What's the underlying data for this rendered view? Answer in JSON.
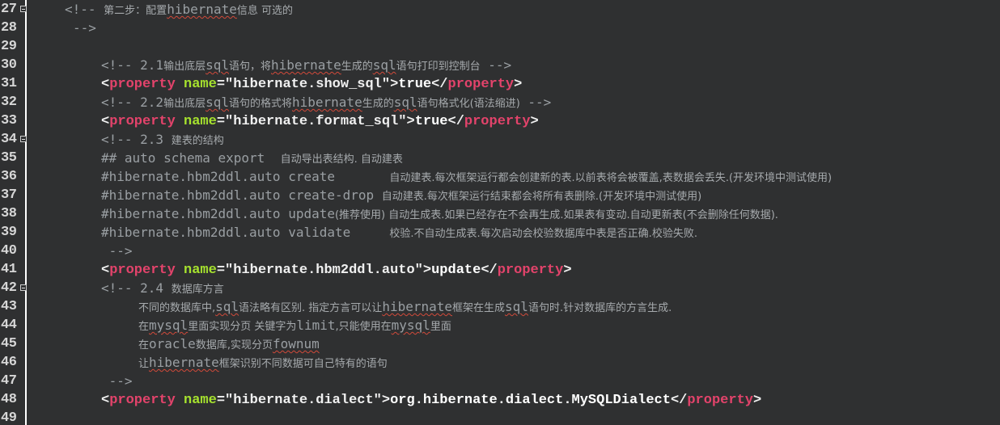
{
  "editor": {
    "lines": [
      {
        "num": "27",
        "fold": true
      },
      {
        "num": "28"
      },
      {
        "num": "29"
      },
      {
        "num": "30"
      },
      {
        "num": "31"
      },
      {
        "num": "32"
      },
      {
        "num": "33"
      },
      {
        "num": "34",
        "fold": true
      },
      {
        "num": "35"
      },
      {
        "num": "36"
      },
      {
        "num": "37"
      },
      {
        "num": "38"
      },
      {
        "num": "39"
      },
      {
        "num": "40"
      },
      {
        "num": "41"
      },
      {
        "num": "42",
        "fold": true
      },
      {
        "num": "43"
      },
      {
        "num": "44"
      },
      {
        "num": "45"
      },
      {
        "num": "46"
      },
      {
        "num": "47"
      },
      {
        "num": "48"
      },
      {
        "num": "49"
      }
    ],
    "code": {
      "l27_a": "<!-- ",
      "l27_b": "第二步：配置",
      "l27_c": "hibernate",
      "l27_d": "信息 可选的",
      "l28": "-->",
      "l30_a": "<!-- 2.1",
      "l30_b": "输出底层",
      "l30_c": "sql",
      "l30_d": "语句，将",
      "l30_e": "hibernate",
      "l30_f": "生成的",
      "l30_g": "sql",
      "l30_h": "语句打印到控制台",
      "l30_i": " -->",
      "l31_open": "<",
      "l31_tag": "property",
      "l31_attr": " name",
      "l31_eq": "=",
      "l31_str": "\"hibernate.show_sql\"",
      "l31_close": ">",
      "l31_val": "true",
      "l31_end_open": "</",
      "l31_end_tag": "property",
      "l31_end_close": ">",
      "l32_a": "<!-- 2.2",
      "l32_b": "输出底层",
      "l32_c": "sql",
      "l32_d": "语句的格式将",
      "l32_e": "hibernate",
      "l32_f": "生成的",
      "l32_g": "sql",
      "l32_h": "语句格式化(语法缩进)",
      "l32_i": " -->",
      "l33_str": "\"hibernate.format_sql\"",
      "l33_val": "true",
      "l34_a": "<!-- 2.3 ",
      "l34_b": "建表的结构",
      "l35_a": "## auto schema export  ",
      "l35_b": "自动导出表结构. 自动建表",
      "l36_a": "#hibernate.hbm2ddl.auto create       ",
      "l36_b": "自动建表.每次框架运行都会创建新的表.以前表将会被覆盖,表数据会丢失.(开发环境中测试使用)",
      "l37_a": "#hibernate.hbm2ddl.auto create-drop ",
      "l37_b": "自动建表.每次框架运行结束都会将所有表删除.(开发环境中测试使用)",
      "l38_a": "#hibernate.hbm2ddl.auto update",
      "l38_b": "(推荐使用) 自动生成表.如果已经存在不会再生成.如果表有变动.自动更新表(不会删除任何数据).",
      "l39_a": "#hibernate.hbm2ddl.auto validate     ",
      "l39_b": "校验.不自动生成表.每次启动会校验数据库中表是否正确.校验失败.",
      "l40": " -->",
      "l41_str": "\"hibernate.hbm2ddl.auto\"",
      "l41_val": "update",
      "l42_a": "<!-- 2.4 ",
      "l42_b": "数据库方言",
      "l43_a": "不同的数据库中,",
      "l43_b": "sql",
      "l43_c": "语法略有区别. 指定方言可以让",
      "l43_d": "hibernate",
      "l43_e": "框架在生成",
      "l43_f": "sql",
      "l43_g": "语句时.针对数据库的方言生成.",
      "l44_a": "在",
      "l44_b": "mysql",
      "l44_c": "里面实现分页 关键字为",
      "l44_d": "limit",
      "l44_e": ",只能使用在",
      "l44_f": "mysql",
      "l44_g": "里面",
      "l45_a": "在",
      "l45_b": "oracle",
      "l45_c": "数据库,实现分页",
      "l45_d": "fownum",
      "l46_a": "让",
      "l46_b": "hibernate",
      "l46_c": "框架识别不同数据可自己特有的语句",
      "l47": " -->",
      "l48_str": "\"hibernate.dialect\"",
      "l48_val": "org.hibernate.dialect.MySQLDialect"
    }
  }
}
